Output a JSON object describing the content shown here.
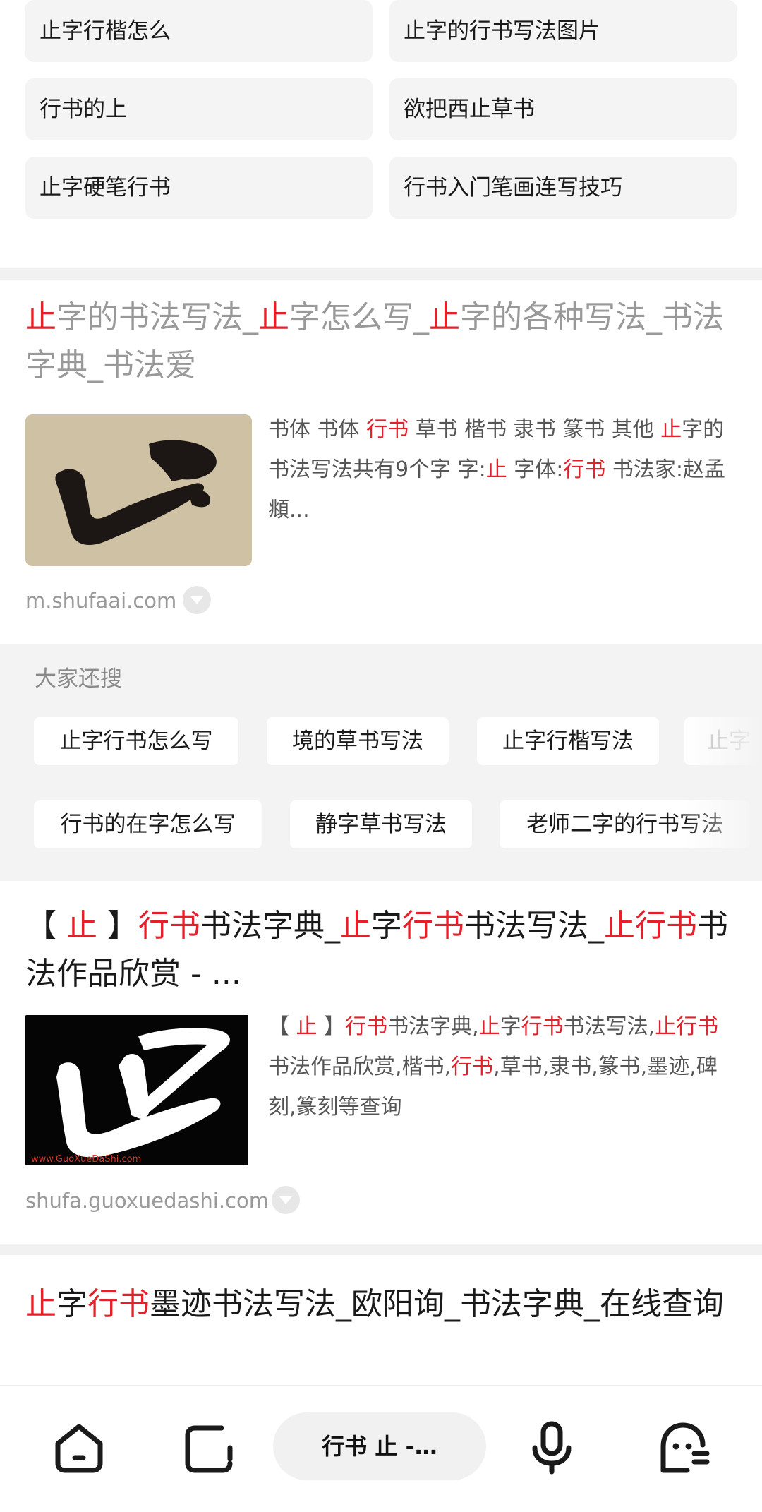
{
  "related_searches": [
    "止字行楷怎么",
    "止字的行书写法图片",
    "行书的上",
    "欲把西止草书",
    "止字硬笔行书",
    "行书入门笔画连写技巧"
  ],
  "result1": {
    "title_parts": [
      "止",
      "字的书法写法_",
      "止",
      "字怎么写_",
      "止",
      "字的各种写法_书法字典_书法爱"
    ],
    "desc_parts": [
      "书体 书体 ",
      "行书",
      " 草书 楷书 隶书 篆书 其他 ",
      "止",
      "字的书法写法共有9个字 字:",
      "止",
      " 字体:",
      "行书",
      " 书法家:赵孟頫..."
    ],
    "site": "m.shufaai.com",
    "thumb_icon": "calligraphy-thumbnail"
  },
  "also_search": {
    "title": "大家还搜",
    "row1": [
      "止字行书怎么写",
      "境的草书写法",
      "止字行楷写法",
      "止字"
    ],
    "row2": [
      "行书的在字怎么写",
      "静字草书写法",
      "老师二字的行书写法"
    ]
  },
  "result2": {
    "title_parts": [
      "【 ",
      "止",
      " 】",
      "行书",
      "书法字典_",
      "止",
      "字",
      "行书",
      "书法写法_",
      "止行书",
      "书法作品欣赏 - ..."
    ],
    "desc_parts": [
      "【 ",
      "止",
      " 】",
      "行书",
      "书法字典,",
      "止",
      "字",
      "行书",
      "书法写法,",
      "止行书",
      "书法作品欣赏,楷书,",
      "行书",
      ",草书,隶书,篆书,墨迹,碑刻,篆刻等查询"
    ],
    "site": "shufa.guoxuedashi.com",
    "thumb_watermark": "www.GuoXueDaShi.com"
  },
  "result3": {
    "title_parts": [
      "止",
      "字",
      "行书",
      "墨迹书法写法_欧阳询_书法字典_在线查询"
    ]
  },
  "bottom_bar": {
    "query": "行书 止 -…",
    "icons": [
      "home-icon",
      "tabs-icon",
      "microphone-icon",
      "assistant-icon"
    ]
  },
  "colors": {
    "highlight": "#e4202a",
    "chip_bg": "#f4f4f4",
    "site": "#9a9a9a"
  }
}
